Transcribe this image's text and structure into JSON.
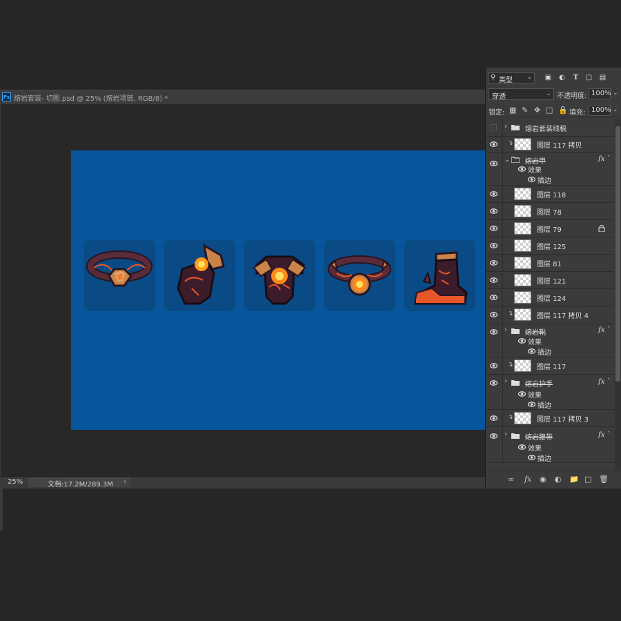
{
  "document": {
    "title": "熔岩套装- 切图.psd @ 25% (熔岩项链, RGB/8) *",
    "app_icon": "Ps",
    "artboard_color": "#07559c",
    "slot_color": "#0a4a85",
    "items": [
      {
        "name": "necklace-icon"
      },
      {
        "name": "gauntlet-icon"
      },
      {
        "name": "chest-armor-icon"
      },
      {
        "name": "belt-icon"
      },
      {
        "name": "boot-icon"
      }
    ]
  },
  "status": {
    "zoom": "25%",
    "doc_size": "文档:17.2M/289.3M",
    "arrow": "›"
  },
  "layers_panel": {
    "filter": {
      "kind_label": "类型"
    },
    "blend_mode": "穿透",
    "opacity_label": "不透明度:",
    "opacity_value": "100%",
    "lock_label": "锁定:",
    "fill_label": "填充:",
    "fill_value": "100%",
    "effects_label": "效果",
    "stroke_label": "描边",
    "layers": [
      {
        "type": "group",
        "name": "熔岩套装线稿",
        "visible": false,
        "collapsed": true
      },
      {
        "type": "layer",
        "name": "图层 117 拷贝",
        "clipped": true
      },
      {
        "type": "group",
        "name": "熔岩甲",
        "collapsed": false,
        "fx": "fx"
      },
      {
        "type": "layer",
        "name": "图层 118"
      },
      {
        "type": "layer",
        "name": "图层 78"
      },
      {
        "type": "layer",
        "name": "图层 79",
        "locked": true
      },
      {
        "type": "layer",
        "name": "图层 125"
      },
      {
        "type": "layer",
        "name": "图层 81"
      },
      {
        "type": "layer",
        "name": "图层 121"
      },
      {
        "type": "layer",
        "name": "图层 124"
      },
      {
        "type": "layer",
        "name": "图层 117 拷贝 4",
        "clipped": true
      },
      {
        "type": "group",
        "name": "熔岩靴",
        "collapsed": true,
        "fx": "fx"
      },
      {
        "type": "layer",
        "name": "图层 117",
        "clipped": true
      },
      {
        "type": "group",
        "name": "熔岩护手",
        "collapsed": true,
        "fx": "fx"
      },
      {
        "type": "layer",
        "name": "图层 117 拷贝 3",
        "clipped": true
      },
      {
        "type": "group",
        "name": "熔岩腰带",
        "collapsed": true,
        "fx": "fx"
      }
    ]
  }
}
